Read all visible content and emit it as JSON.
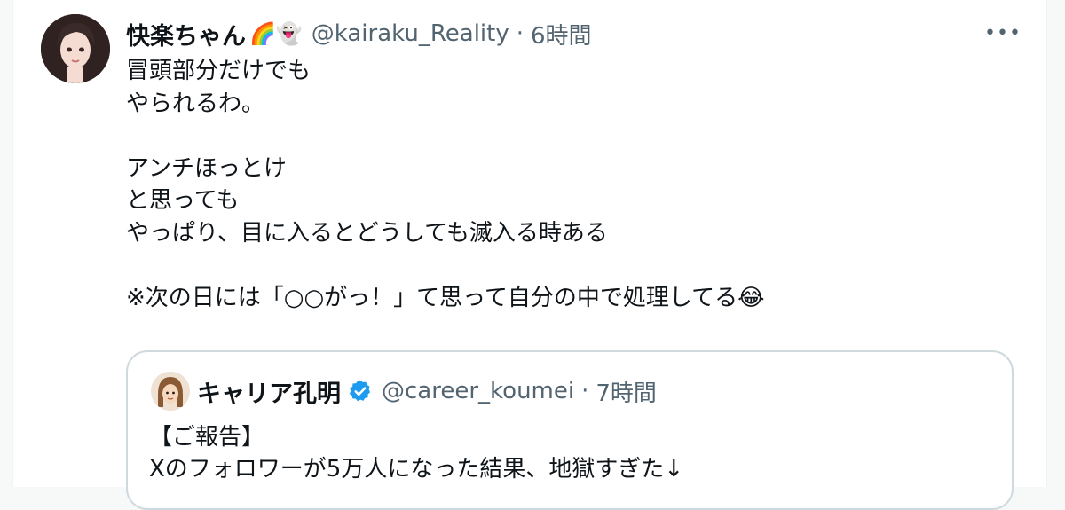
{
  "tweet": {
    "display_name": "快楽ちゃん",
    "name_emojis": "🌈👻",
    "handle": "@kairaku_Reality",
    "separator": "·",
    "time": "6時間",
    "more_label": "•••",
    "body_lines": [
      "冒頭部分だけでも",
      "やられるわ。",
      "",
      "アンチほっとけ",
      "と思っても",
      "やっぱり、目に入るとどうしても滅入る時ある",
      "",
      "※次の日には「○○がっ！」て思って自分の中で処理してる😂"
    ]
  },
  "quoted": {
    "display_name": "キャリア孔明",
    "handle": "@career_koumei",
    "separator": "·",
    "time": "7時間",
    "body_lines": [
      "【ご報告】",
      "Xのフォロワーが5万人になった結果、地獄すぎた↓"
    ],
    "verified_color": "#1d9bf0"
  },
  "colors": {
    "text": "#0f1419",
    "secondary": "#536471",
    "border": "#cfd9de"
  }
}
